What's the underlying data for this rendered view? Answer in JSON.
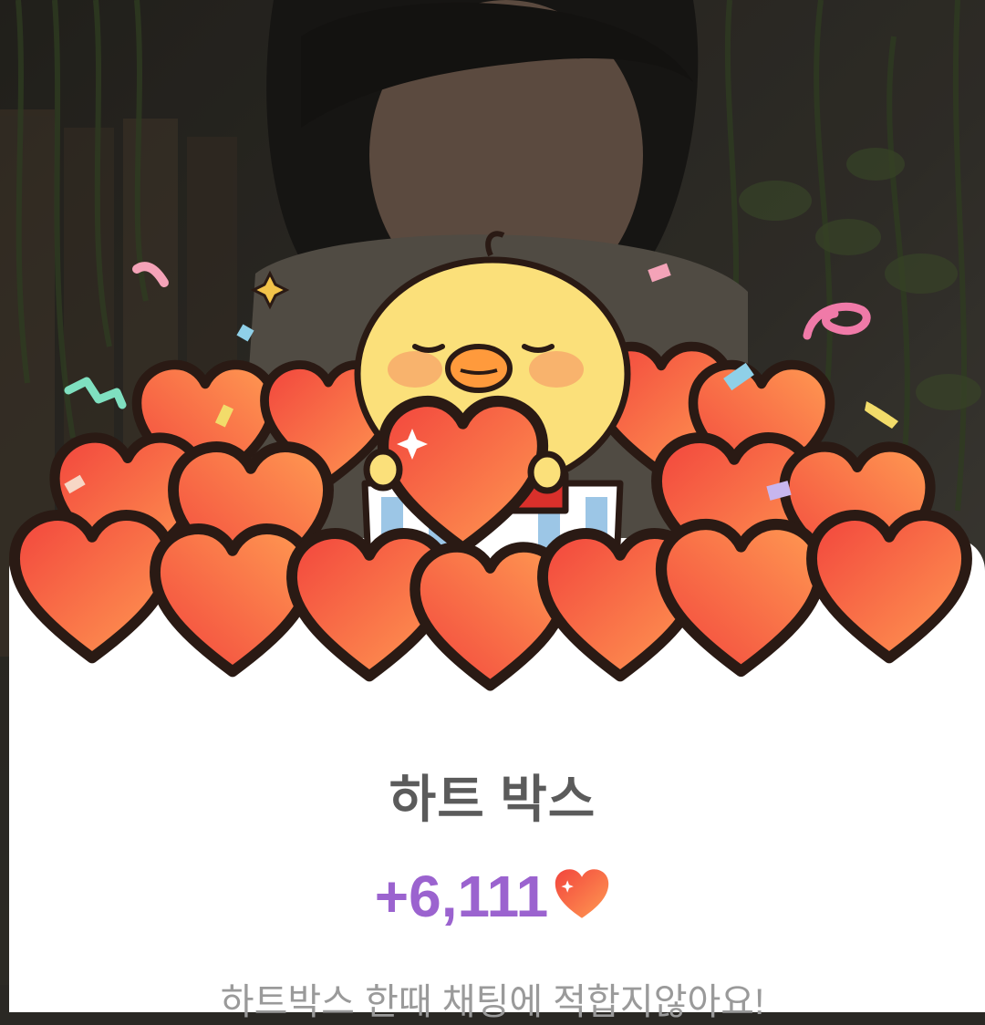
{
  "reward_dialog": {
    "title": "하트 박스",
    "amount": "+6,111",
    "subtitle": "하트박스 한때 채팅에 적합지않아요!"
  },
  "colors": {
    "amount_purple": "#9b63cf",
    "title_gray": "#5b5b5b",
    "heart_red": "#f2453d",
    "heart_orange": "#ff9a52",
    "chick_yellow": "#fbe07a"
  },
  "icons": [
    "heart-icon",
    "chick-mascot",
    "gift-box",
    "confetti",
    "sparkle-icon"
  ]
}
